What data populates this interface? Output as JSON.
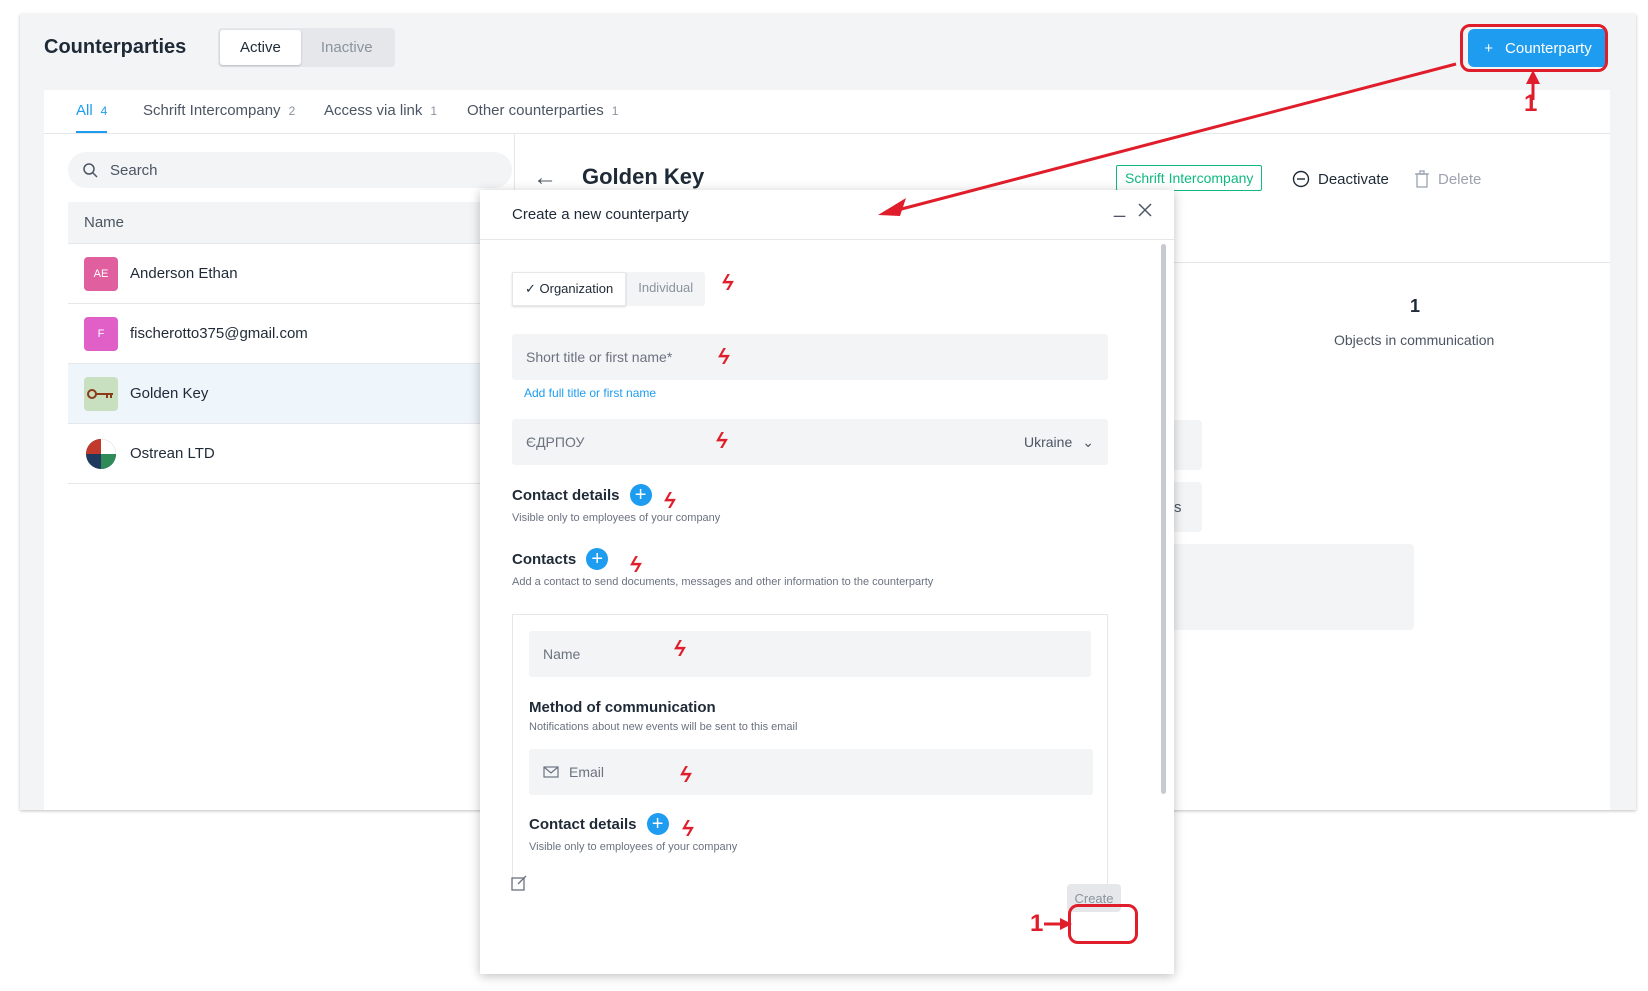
{
  "header": {
    "title": "Counterparties",
    "toggle": [
      "Active",
      "Inactive"
    ],
    "add_button": "Counterparty"
  },
  "tabs": [
    {
      "label": "All",
      "count": "4"
    },
    {
      "label": "Schrift Intercompany",
      "count": "2"
    },
    {
      "label": "Access via link",
      "count": "1"
    },
    {
      "label": "Other counterparties",
      "count": "1"
    }
  ],
  "list": {
    "search_placeholder": "Search",
    "column": "Name",
    "rows": [
      {
        "initials": "AE",
        "name": "Anderson Ethan",
        "color": "#e0609f"
      },
      {
        "initials": "F",
        "name": "fischerotto375@gmail.com",
        "color": "#e060c8"
      },
      {
        "initials": "",
        "name": "Golden Key",
        "color": "#c8e0c0"
      },
      {
        "initials": "",
        "name": "Ostrean LTD",
        "color": "#ffffff"
      }
    ]
  },
  "detail": {
    "title": "Golden Key",
    "tag": "Schrift Intercompany",
    "deactivate": "Deactivate",
    "delete": "Delete",
    "objects_count": "1",
    "objects_label": "Objects in communication",
    "others": "Others"
  },
  "modal": {
    "title": "Create a new counterparty",
    "type_options": [
      "Organization",
      "Individual"
    ],
    "short_title_placeholder": "Short title or first name*",
    "add_full_title": "Add full title or first name",
    "edrpou_placeholder": "ЄДРПОУ",
    "country": "Ukraine",
    "contact_details": "Contact details",
    "contact_details_note": "Visible only to employees of your company",
    "contacts": "Contacts",
    "contacts_note": "Add a contact to send documents, messages and other information to the counterparty",
    "contact_name_placeholder": "Name",
    "method_title": "Method of communication",
    "method_note": "Notifications about new events will be sent to this email",
    "email_placeholder": "Email",
    "contact_details_2": "Contact details",
    "contact_details_2_note": "Visible only to employees of your company",
    "create_button": "Create"
  },
  "annotations": {
    "step_top": "1",
    "step_bottom": "1"
  },
  "colors": {
    "accent": "#1e9cf0",
    "annotation": "#e01e2b",
    "tag_green": "#10b981"
  }
}
